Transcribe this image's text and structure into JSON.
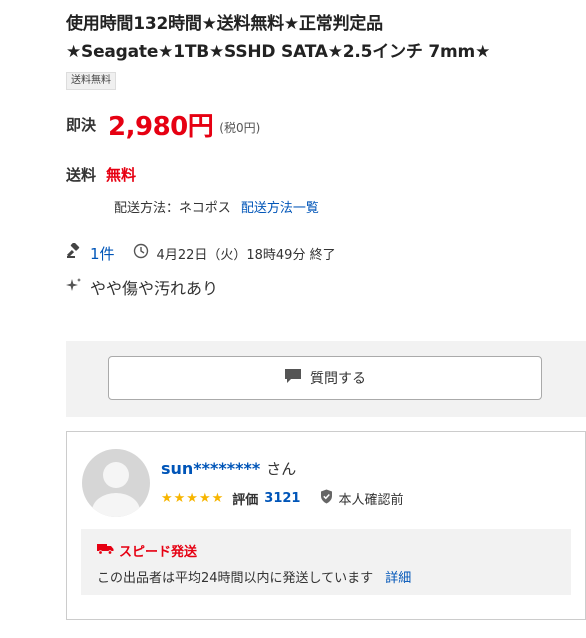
{
  "listing": {
    "title": "使用時間132時間★送料無料★正常判定品★Seagate★1TB★SSHD SATA★2.5インチ 7mm★",
    "badge": "送料無料"
  },
  "price": {
    "label": "即決",
    "value": "2,980円",
    "tax": "(税0円)"
  },
  "shipping": {
    "label": "送料",
    "value": "無料",
    "method_text": "配送方法：ネコポス",
    "method_link": "配送方法一覧"
  },
  "bids": {
    "count": "1件",
    "end_time": "4月22日（火）18時49分 終了"
  },
  "condition": {
    "text": "やや傷や汚れあり"
  },
  "question": {
    "button_label": "質問する"
  },
  "seller": {
    "name": "sun********",
    "honorific": "さん",
    "stars": "★★★★★",
    "rating_label": "評価",
    "rating_value": "3121",
    "verified_label": "本人確認前",
    "speed_title": "スピード発送",
    "speed_desc": "この出品者は平均24時間以内に発送しています",
    "speed_link": "詳細"
  },
  "colors": {
    "accent_red": "#e60012",
    "link_blue": "#0055b8",
    "star_yellow": "#f7b500"
  },
  "icons": [
    "gavel-icon",
    "clock-icon",
    "sparkle-icon",
    "chat-bubble-icon",
    "avatar-placeholder-icon",
    "shield-check-icon",
    "truck-icon"
  ]
}
